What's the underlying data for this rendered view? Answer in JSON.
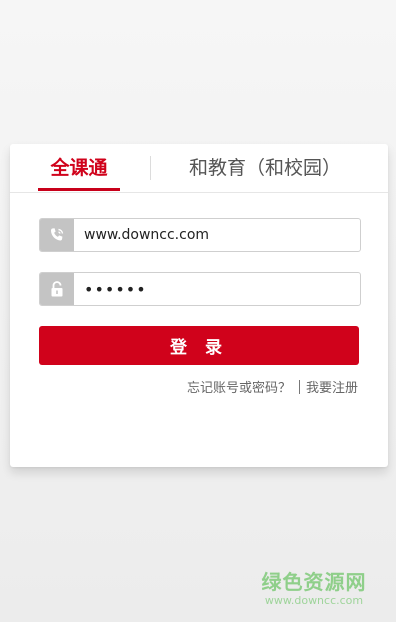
{
  "tabs": {
    "active": "全课通",
    "other": "和教育（和校园）"
  },
  "form": {
    "username_value": "www.downcc.com",
    "password_value": "••••••",
    "login_label": "登 录"
  },
  "links": {
    "forgot": "忘记账号或密码？",
    "register": "我要注册"
  },
  "watermark": {
    "main": "绿色资源网",
    "sub": "www.downcc.com"
  },
  "icons": {
    "username": "phone-icon",
    "password": "lock-icon"
  },
  "colors": {
    "accent": "#d0021b",
    "icon_bg": "#c4c4c4",
    "watermark": "#8fcf8a"
  }
}
